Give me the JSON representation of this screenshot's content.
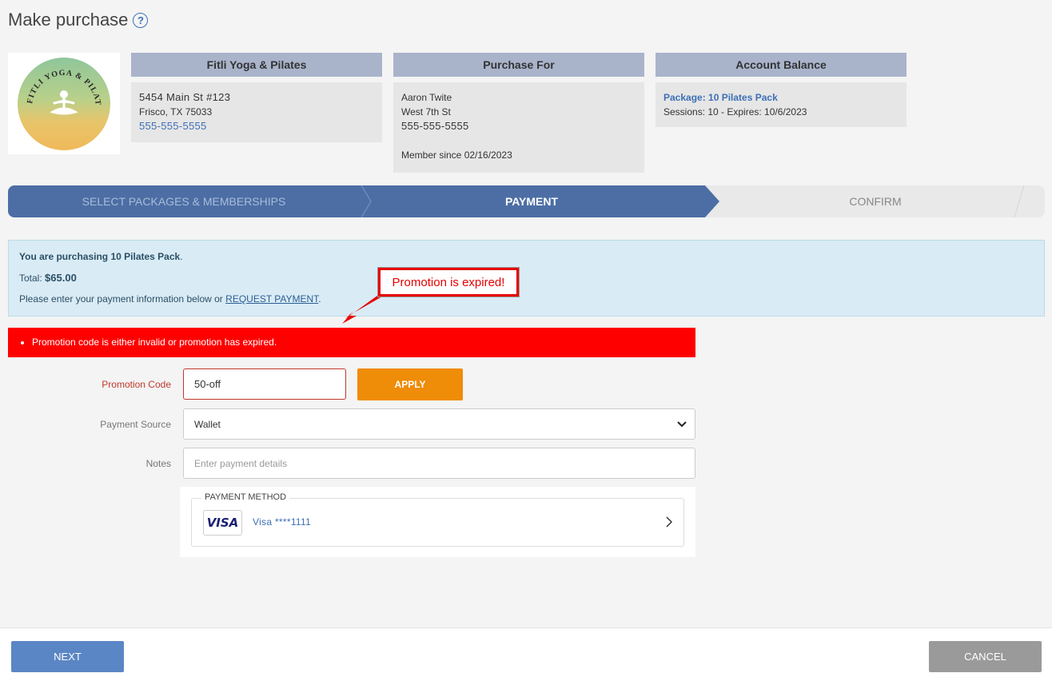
{
  "page": {
    "title": "Make purchase",
    "help_icon": "help-circle-icon"
  },
  "studio": {
    "name": "Fitli Yoga & Pilates",
    "address1": "5454 Main St #123",
    "address2": "Frisco, TX 75033",
    "phone": "555-555-5555",
    "logo_text": "FITLI YOGA & PILATES"
  },
  "purchase_for": {
    "header": "Purchase For",
    "name": "Aaron Twite",
    "street": "West 7th St",
    "phone": "555-555-5555",
    "member_since": "Member since 02/16/2023"
  },
  "account_balance": {
    "header": "Account Balance",
    "package": "Package: 10 Pilates Pack",
    "details": "Sessions: 10 - Expires: 10/6/2023"
  },
  "steps": [
    {
      "label": "SELECT PACKAGES & MEMBERSHIPS",
      "state": "done"
    },
    {
      "label": "PAYMENT",
      "state": "active"
    },
    {
      "label": "CONFIRM",
      "state": "pending"
    }
  ],
  "info": {
    "purchasing_bold": "You are purchasing 10 Pilates Pack",
    "purchasing_end": ".",
    "total_label": "Total:",
    "total_value": "$65.00",
    "instructions": "Please enter your payment information below or",
    "request_link": "REQUEST PAYMENT",
    "instructions_end": "."
  },
  "callout": {
    "text": "Promotion is expired!"
  },
  "alert": {
    "message": "Promotion code is either invalid or promotion has expired."
  },
  "form": {
    "promo_label": "Promotion Code",
    "promo_value": "50-off",
    "apply_label": "APPLY",
    "source_label": "Payment Source",
    "source_value": "Wallet",
    "notes_label": "Notes",
    "notes_placeholder": "Enter payment details"
  },
  "payment_method": {
    "legend": "PAYMENT METHOD",
    "brand": "VISA",
    "card": "Visa ****1111"
  },
  "footer": {
    "next_label": "NEXT",
    "cancel_label": "CANCEL"
  },
  "colors": {
    "accent_blue": "#4c6ea5",
    "apply_orange": "#ef8c08",
    "error_red": "#ff0000",
    "info_bg": "#d9ebf5"
  }
}
